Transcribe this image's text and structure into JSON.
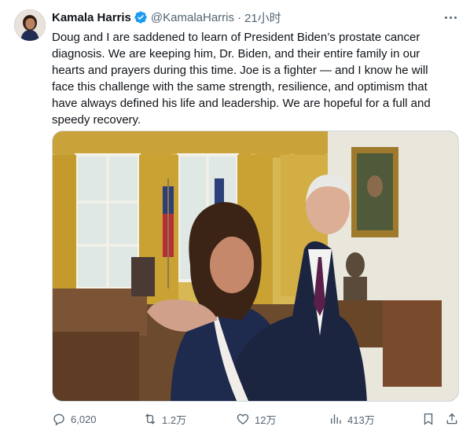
{
  "author": {
    "display_name": "Kamala Harris",
    "handle": "@KamalaHarris",
    "separator": "·",
    "time": "21小时"
  },
  "tweet": {
    "text": "Doug and I are saddened to learn of President Biden’s prostate cancer\ndiagnosis. We are keeping him, Dr. Biden, and their entire family in our\nhearts and prayers during this time. Joe is a fighter — and I know he will\nface this challenge with the same strength, resilience, and optimism that\nhave always defined his life and leadership. We are hopeful for a full and\nspeedy recovery."
  },
  "actions": {
    "replies": "6,020",
    "retweets": "1.2万",
    "likes": "12万",
    "views": "413万"
  },
  "icons": {
    "verified": "verified-badge-icon",
    "more": "more-dots-icon",
    "reply": "reply-icon",
    "retweet": "retweet-icon",
    "like": "heart-icon",
    "views": "views-bar-chart-icon",
    "bookmark": "bookmark-icon",
    "share": "share-icon"
  },
  "colors": {
    "verified": "#1d9bf0",
    "secondary_text": "#536471",
    "primary_text": "#0f1419"
  }
}
